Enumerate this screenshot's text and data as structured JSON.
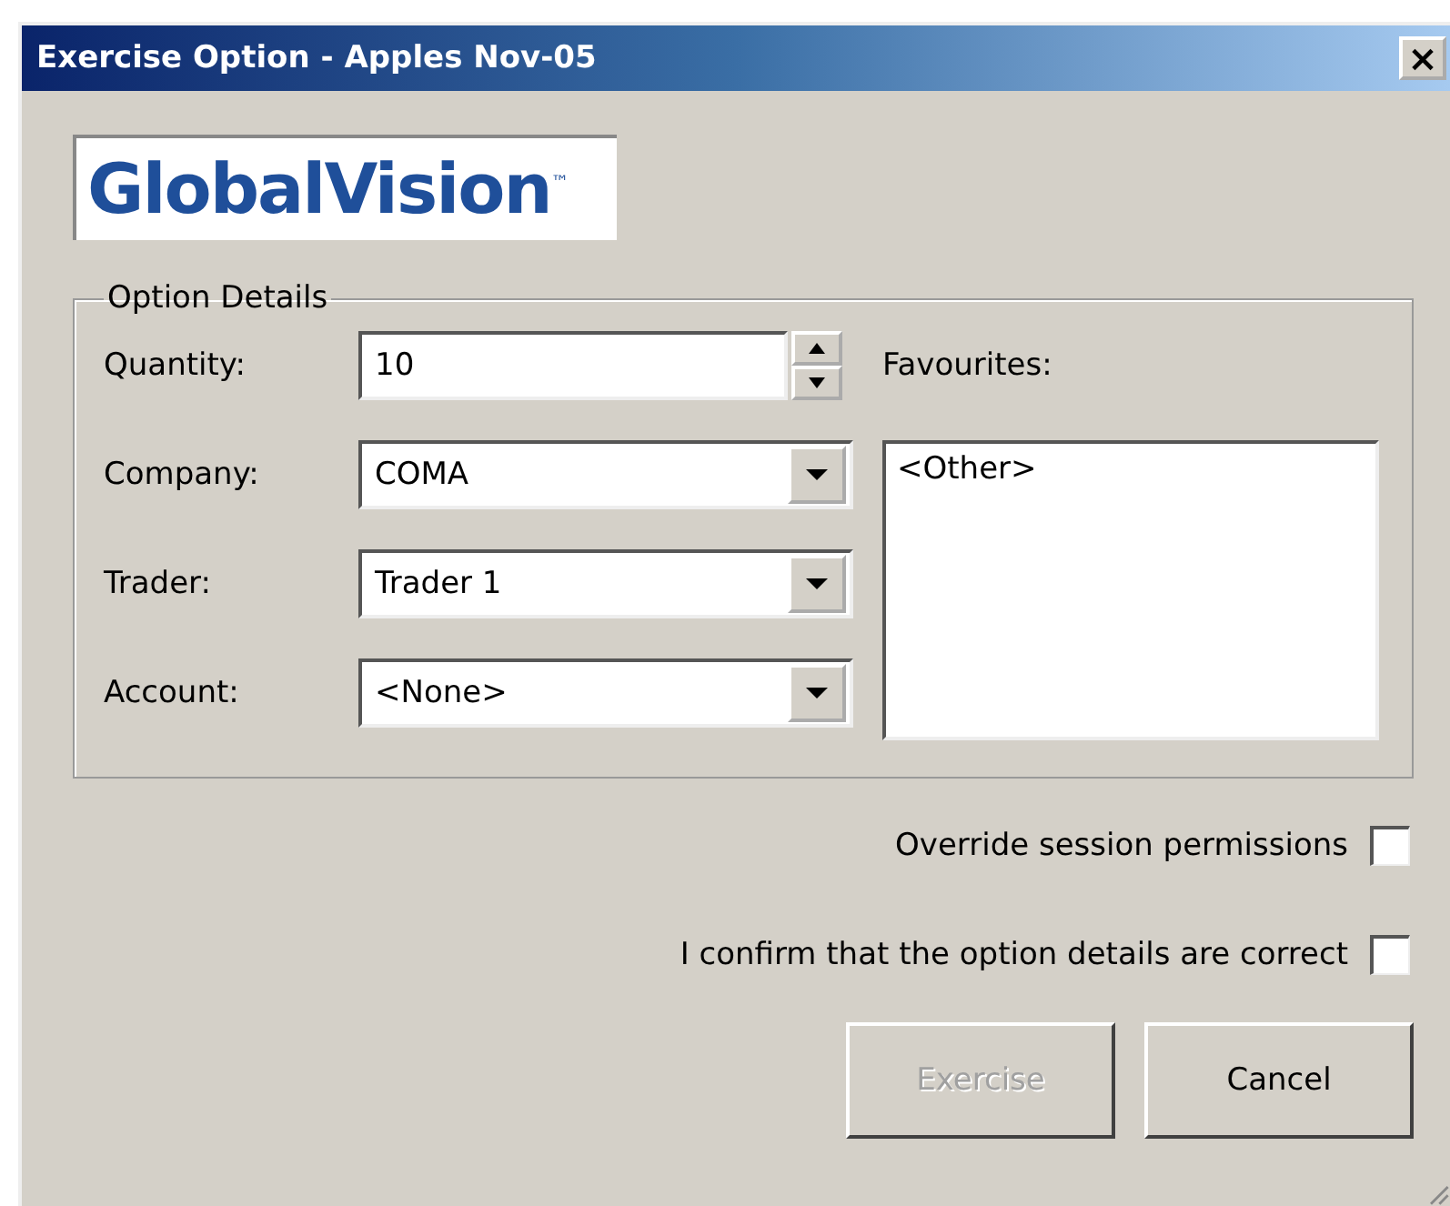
{
  "window": {
    "title": "Exercise Option - Apples Nov-05",
    "close": "×"
  },
  "logo": {
    "text": "GlobalVision$^{™}$"
  },
  "option_details": {
    "title": "Option Details",
    "fields": [
      {
        "kind": "spin",
        "label": "Quantity:",
        "value": "10"
      },
      {
        "kind": "dropdown",
        "label": "Company:",
        "value": "COMA"
      },
      {
        "kind": "dropdown",
        "label": "Trader:",
        "value": "Trader 1"
      },
      {
        "kind": "dropdown",
        "label": "Account:",
        "value": "<None>"
      }
    ],
    "favourites": {
      "label": "Favourites:",
      "items": [
        {
          "text": "<Other>",
          "selected": false
        }
      ]
    }
  },
  "checkboxes": [
    {
      "label": "Override session permissions",
      "checked": false
    },
    {
      "label": "I confirm that the option details are correct",
      "checked": false
    }
  ],
  "buttons": [
    {
      "label": "Exercise",
      "disabled": true
    },
    {
      "label": "Cancel",
      "disabled": false
    }
  ]
}
